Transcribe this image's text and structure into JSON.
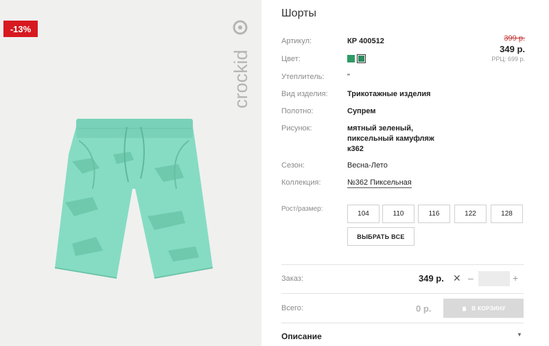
{
  "gallery": {
    "discount_badge": "-13%",
    "watermark_brand": "crockid"
  },
  "product": {
    "title": "Шорты",
    "attributes": [
      {
        "label": "Артикул:",
        "value": "КР 400512"
      },
      {
        "label": "Цвет:",
        "value": ""
      },
      {
        "label": "Утеплитель:",
        "value": "\""
      },
      {
        "label": "Вид изделия:",
        "value": "Трикотажные изделия"
      },
      {
        "label": "Полотно:",
        "value": "Супрем"
      },
      {
        "label": "Рисунок:",
        "value_lines": [
          "мятный зеленый,",
          "пиксельный камуфляж",
          "к362"
        ]
      },
      {
        "label": "Сезон:",
        "value": "Весна-Лето"
      },
      {
        "label": "Коллекция:",
        "value": "№362 Пиксельная"
      }
    ],
    "colors": [
      "#2f9a66",
      "#2f8a5e"
    ]
  },
  "pricing": {
    "old_price": "399 р.",
    "new_price": "349 р.",
    "rrp": "РРЦ: 699 р."
  },
  "sizes": {
    "label": "Рост/размер:",
    "options": [
      "104",
      "110",
      "116",
      "122",
      "128"
    ],
    "select_all": "ВЫБРАТЬ ВСЕ"
  },
  "order": {
    "label": "Заказ:",
    "price": "349 р.",
    "quantity": "",
    "minus": "–",
    "plus": "+",
    "times": "✕"
  },
  "total": {
    "label": "Всего:",
    "value": "0 р.",
    "cart_button": "В КОРЗИНУ"
  },
  "description": {
    "label": "Описание",
    "chevron": "▼"
  }
}
